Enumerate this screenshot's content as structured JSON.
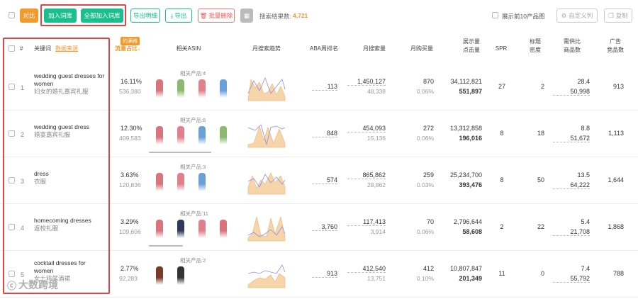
{
  "toolbar": {
    "compare": "对比",
    "add_to_lib": "加入词库",
    "add_all_to_lib": "全部加入词库",
    "export_detail": "导出明细",
    "export": "导出",
    "batch_delete": "批量删除",
    "search_result_label": "搜索结果数:",
    "search_result_count": "4,721",
    "show_top10": "展示前10产品图",
    "custom_columns": "自定义列",
    "copy": "复制"
  },
  "headers": {
    "index": "#",
    "keyword": "关键词",
    "keyword_source": "数据来源",
    "traffic_badge": "约满格",
    "traffic_share": "流量占比",
    "related_asin": "相关ASIN",
    "monthly_trend": "月搜索趋势",
    "aba_rank": "ABA周排名",
    "monthly_search": "月搜索量",
    "monthly_purchase": "月购买量",
    "impressions_l1": "展示量",
    "impressions_l2": "点击量",
    "spr": "SPR",
    "title_density_l1": "标题",
    "title_density_l2": "密度",
    "supply_demand_l1": "需供比",
    "supply_demand_l2": "商品数",
    "ad_l1": "广告",
    "ad_l2": "竞品数"
  },
  "related_prefix": "相关产品:",
  "rows": [
    {
      "idx": "1",
      "kw_l1": "wedding guest dresses for",
      "kw_l2": "women",
      "kw_cn": "妇女的婚礼嘉宾礼服",
      "share": "16.11%",
      "share_sub": "536,380",
      "related": "4",
      "aba": "113",
      "search": "1,450,127",
      "search_sub": "48,338",
      "purchase": "870",
      "purchase_sub": "0.06%",
      "imp": "34,112,821",
      "clicks": "551,897",
      "spr": "27",
      "title": "2",
      "sd": "28.4",
      "sd_sub": "50,998",
      "ad": "913",
      "dresses": [
        "#d9747c",
        "#8db870",
        "#e0808a",
        "#6aa0d8"
      ]
    },
    {
      "idx": "2",
      "kw_l1": "wedding guest dress",
      "kw_l2": "",
      "kw_cn": "婚宴嘉宾礼服",
      "share": "12.30%",
      "share_sub": "409,583",
      "related": "6",
      "aba": "848",
      "search": "454,093",
      "search_sub": "15,136",
      "purchase": "272",
      "purchase_sub": "0.06%",
      "imp": "13,312,858",
      "clicks": "196,016",
      "spr": "8",
      "title": "18",
      "sd": "8.8",
      "sd_sub": "51,672",
      "ad": "1,113",
      "dresses": [
        "#d9747c",
        "#e0808a",
        "#6aa0d8",
        "#8db870"
      ]
    },
    {
      "idx": "3",
      "kw_l1": "dress",
      "kw_l2": "",
      "kw_cn": "衣服",
      "share": "3.63%",
      "share_sub": "120,836",
      "related": "3",
      "aba": "574",
      "search": "865,862",
      "search_sub": "28,862",
      "purchase": "259",
      "purchase_sub": "0.03%",
      "imp": "25,234,700",
      "clicks": "393,476",
      "spr": "8",
      "title": "50",
      "sd": "13.5",
      "sd_sub": "64,222",
      "ad": "1,644",
      "dresses": [
        "#d9747c",
        "#e0808a",
        "#6aa0d8"
      ]
    },
    {
      "idx": "4",
      "kw_l1": "homecoming dresses",
      "kw_l2": "",
      "kw_cn": "返校礼服",
      "share": "3.29%",
      "share_sub": "109,606",
      "related": "11",
      "aba": "3,760",
      "search": "117,413",
      "search_sub": "3,914",
      "purchase": "70",
      "purchase_sub": "0.06%",
      "imp": "2,796,644",
      "clicks": "58,608",
      "spr": "2",
      "title": "22",
      "sd": "5.4",
      "sd_sub": "21,708",
      "ad": "1,868",
      "dresses": [
        "#d9747c",
        "#2e3a5a",
        "#e0808a",
        "#d9747c"
      ]
    },
    {
      "idx": "5",
      "kw_l1": "cocktail dresses for",
      "kw_l2": "women",
      "kw_cn": "女士鸡尾酒裙",
      "share": "2.77%",
      "share_sub": "92,283",
      "related": "2",
      "aba": "913",
      "search": "412,540",
      "search_sub": "13,751",
      "purchase": "412",
      "purchase_sub": "0.10%",
      "imp": "10,807,847",
      "clicks": "201,349",
      "spr": "11",
      "title": "0",
      "sd": "7.4",
      "sd_sub": "55,792",
      "ad": "788",
      "dresses": [
        "#7a3a2a",
        "#333333"
      ]
    }
  ],
  "watermark": "大数跨境",
  "colors": {
    "orange": "#f39a2c",
    "green": "#1bbf8d",
    "red_box": "#e04444",
    "search_count": "#f39a2c",
    "trend_fill": "#f6d5aa",
    "trend_line": "#8b8fe8"
  },
  "icons": [
    "checkbox-icon",
    "download-icon",
    "delete-icon",
    "calendar-icon",
    "columns-icon",
    "copy-icon",
    "sort-down-icon",
    "watermark-logo-icon"
  ]
}
